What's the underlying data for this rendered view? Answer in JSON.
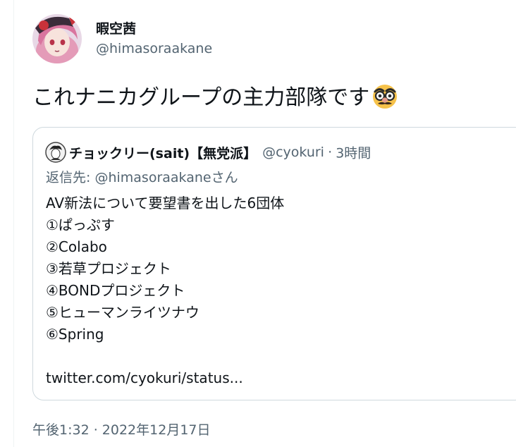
{
  "author": {
    "display_name": "暇空茜",
    "handle": "@himasoraakane"
  },
  "tweet": {
    "text": "これナニカグループの主力部隊です",
    "emoji": "disguised-face-emoji"
  },
  "quote": {
    "display_name": "チョックリー(sait)【無党派】",
    "handle": "@cyokuri",
    "dot": "·",
    "time": "3時間",
    "reply_prefix": "返信先: ",
    "reply_handle": "@himasoraakane",
    "reply_suffix": "さん",
    "lines": [
      "AV新法について要望書を出した6団体",
      "①ぱっぷす",
      "②Colabo",
      "③若草プロジェクト",
      "④BONDプロジェクト",
      "⑤ヒューマンライツナウ",
      "⑥Spring"
    ],
    "link": "twitter.com/cyokuri/status..."
  },
  "timestamp": "午後1:32 · 2022年12月17日",
  "colors": {
    "text_primary": "#0f1419",
    "text_secondary": "#536471",
    "border": "#cfd9de"
  }
}
